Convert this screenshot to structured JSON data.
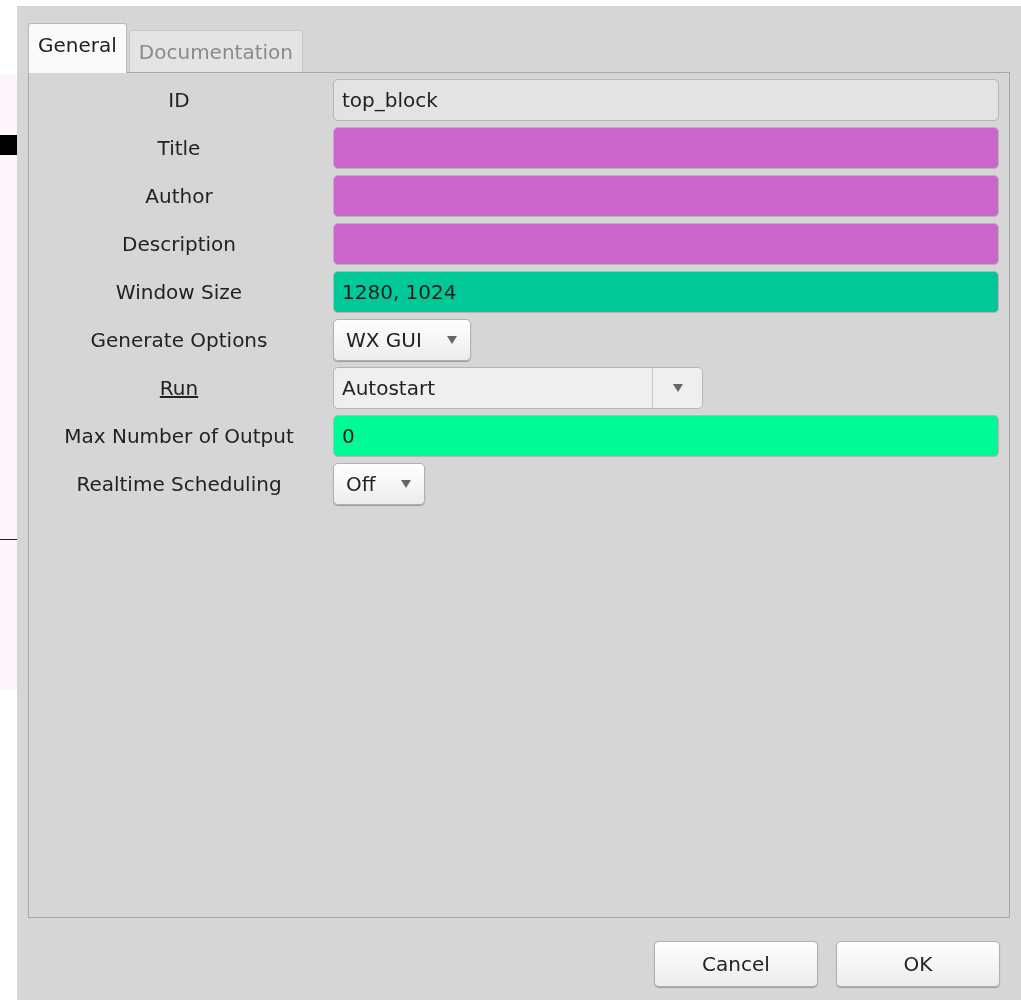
{
  "tabs": [
    {
      "label": "General",
      "selected": true
    },
    {
      "label": "Documentation",
      "selected": false
    }
  ],
  "fields": [
    {
      "label": "ID",
      "kind": "entry",
      "value": "top_block",
      "color": "#e3e3e3",
      "underlined": false
    },
    {
      "label": "Title",
      "kind": "entry",
      "color": "#cc66cc",
      "underlined": false
    },
    {
      "label": "Author",
      "kind": "entry",
      "color": "#cc66cc",
      "underlined": false
    },
    {
      "label": "Description",
      "kind": "entry",
      "color": "#cc66cc",
      "underlined": false
    },
    {
      "label": "Window Size",
      "kind": "entry",
      "value": "1280, 1024",
      "color": "#00c896",
      "underlined": false
    },
    {
      "label": "Generate Options",
      "kind": "dropdown",
      "value": "WX GUI",
      "underlined": false
    },
    {
      "label": "Run",
      "kind": "combobox",
      "value": "Autostart",
      "underlined": true
    },
    {
      "label": "Max Number of Output",
      "kind": "entry",
      "value": "0",
      "color": "#00fa96",
      "underlined": false
    },
    {
      "label": "Realtime Scheduling",
      "kind": "dropdown",
      "value": "Off",
      "underlined": false
    }
  ],
  "buttons": [
    "Cancel",
    "OK"
  ]
}
